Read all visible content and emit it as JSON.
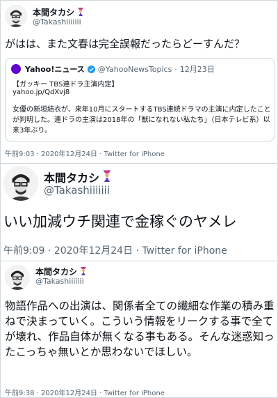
{
  "tweets": [
    {
      "display_name": "本間タカシ",
      "badge_icon": "guardian-figure-icon",
      "handle": "@Takashiiiiiii",
      "text": "がはは、また文春は完全誤報だったらどーすんだ？",
      "quote": {
        "logo_icon": "yahoo-logo-icon",
        "name": "Yahoo!ニュース",
        "verified_icon": "verified-badge-icon",
        "handle": "@YahooNewsTopics",
        "separator": "·",
        "date": "12月23日",
        "headline": "【ガッキー TBS連ドラ主演内定】",
        "url": "yahoo.jp/QdXvj8",
        "text": "女優の新垣結衣が、来年10月にスタートするTBS連続ドラマの主演に内定したことが判明した。連ドラの主演は2018年の「獣になれない私たち」（日本テレビ系）以来3年ぶり。"
      },
      "time": "午前9:03",
      "separator": "·",
      "date": "2020年12月24日",
      "source": "Twitter for iPhone"
    },
    {
      "display_name": "本間タカシ",
      "badge_icon": "guardian-figure-icon",
      "handle": "@Takashiiiiiii",
      "text": "いい加減ウチ関連で金稼ぐのヤメレ",
      "time": "午前9:09",
      "separator": "·",
      "date": "2020年12月24日",
      "source": "Twitter for iPhone"
    },
    {
      "display_name": "本間タカシ",
      "badge_icon": "guardian-figure-icon",
      "handle": "@Takashiiiiiii",
      "text": "物語作品への出演は、関係者全ての繊細な作業の積み重ねで決まっていく。こういう情報をリークする事で全てが壊れ、作品自体が無くなる事もある。そんな迷惑知ったこっちゃ無いとか思わないでほしい。",
      "time": "午前9:38",
      "separator": "·",
      "date": "2020年12月24日",
      "source": "Twitter for iPhone"
    }
  ],
  "colors": {
    "text": "#0f1419",
    "secondary": "#536471",
    "border": "#cfd9de",
    "yahoo_purple": "#5f01d1",
    "verified_blue": "#1d9bf0"
  }
}
